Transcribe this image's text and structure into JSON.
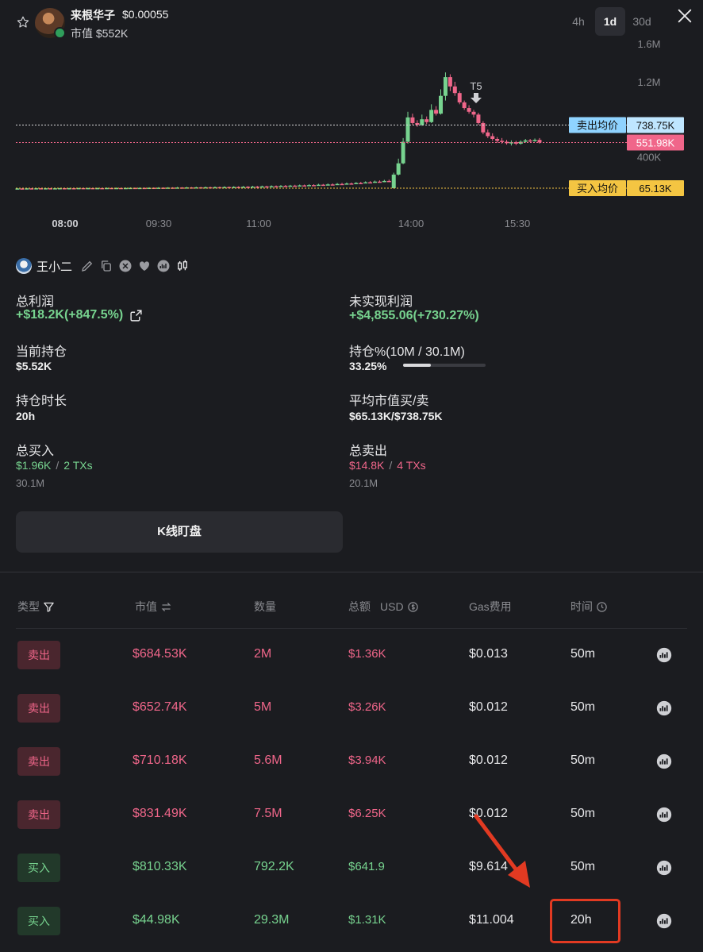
{
  "header": {
    "token_name": "来根华子",
    "token_price": "$0.00055",
    "market_cap": "市值 $552K",
    "ranges": [
      {
        "label": "4h",
        "active": false
      },
      {
        "label": "1d",
        "active": true
      },
      {
        "label": "30d",
        "active": false
      }
    ],
    "icons": {
      "favorite": "star-icon",
      "close": "close-icon"
    }
  },
  "chart_data": {
    "type": "candlestick",
    "x_ticks": [
      "08:00",
      "09:30",
      "11:00",
      "14:00",
      "15:30"
    ],
    "y_ticks": [
      "1.6M",
      "1.2M",
      "400K"
    ],
    "marker": "T5",
    "reference_lines": [
      {
        "label": "卖出均价",
        "value": "738.75K",
        "color": "#8fd3ff"
      },
      {
        "label": "",
        "value": "551.98K",
        "color": "#f0668a"
      },
      {
        "label": "买入均价",
        "value": "65.13K",
        "color": "#f4c542"
      }
    ],
    "candles": [
      {
        "o": 60,
        "c": 62,
        "h": 65,
        "l": 58
      },
      {
        "o": 62,
        "c": 61,
        "h": 64,
        "l": 59
      },
      {
        "o": 61,
        "c": 63,
        "h": 66,
        "l": 60
      },
      {
        "o": 63,
        "c": 62,
        "h": 65,
        "l": 60
      },
      {
        "o": 62,
        "c": 64,
        "h": 67,
        "l": 61
      },
      {
        "o": 64,
        "c": 63,
        "h": 66,
        "l": 61
      },
      {
        "o": 63,
        "c": 64,
        "h": 66,
        "l": 62
      },
      {
        "o": 64,
        "c": 62,
        "h": 66,
        "l": 61
      },
      {
        "o": 62,
        "c": 64,
        "h": 67,
        "l": 61
      },
      {
        "o": 64,
        "c": 65,
        "h": 68,
        "l": 62
      },
      {
        "o": 65,
        "c": 63,
        "h": 67,
        "l": 62
      },
      {
        "o": 63,
        "c": 65,
        "h": 68,
        "l": 62
      },
      {
        "o": 65,
        "c": 64,
        "h": 67,
        "l": 62
      },
      {
        "o": 64,
        "c": 66,
        "h": 69,
        "l": 63
      },
      {
        "o": 66,
        "c": 65,
        "h": 68,
        "l": 63
      },
      {
        "o": 65,
        "c": 66,
        "h": 69,
        "l": 64
      },
      {
        "o": 66,
        "c": 64,
        "h": 68,
        "l": 62
      },
      {
        "o": 64,
        "c": 66,
        "h": 70,
        "l": 63
      },
      {
        "o": 66,
        "c": 65,
        "h": 69,
        "l": 63
      },
      {
        "o": 65,
        "c": 67,
        "h": 72,
        "l": 64
      },
      {
        "o": 67,
        "c": 66,
        "h": 70,
        "l": 64
      },
      {
        "o": 66,
        "c": 67,
        "h": 71,
        "l": 65
      },
      {
        "o": 67,
        "c": 65,
        "h": 69,
        "l": 63
      },
      {
        "o": 65,
        "c": 67,
        "h": 72,
        "l": 64
      },
      {
        "o": 67,
        "c": 68,
        "h": 74,
        "l": 66
      },
      {
        "o": 68,
        "c": 66,
        "h": 71,
        "l": 64
      },
      {
        "o": 66,
        "c": 68,
        "h": 73,
        "l": 65
      },
      {
        "o": 68,
        "c": 67,
        "h": 72,
        "l": 65
      },
      {
        "o": 67,
        "c": 69,
        "h": 74,
        "l": 66
      },
      {
        "o": 69,
        "c": 68,
        "h": 73,
        "l": 66
      },
      {
        "o": 68,
        "c": 70,
        "h": 75,
        "l": 67
      },
      {
        "o": 70,
        "c": 69,
        "h": 74,
        "l": 67
      },
      {
        "o": 69,
        "c": 71,
        "h": 76,
        "l": 68
      },
      {
        "o": 71,
        "c": 70,
        "h": 75,
        "l": 68
      },
      {
        "o": 70,
        "c": 72,
        "h": 78,
        "l": 69
      },
      {
        "o": 72,
        "c": 71,
        "h": 76,
        "l": 69
      },
      {
        "o": 71,
        "c": 73,
        "h": 79,
        "l": 70
      },
      {
        "o": 73,
        "c": 72,
        "h": 77,
        "l": 70
      },
      {
        "o": 72,
        "c": 74,
        "h": 80,
        "l": 71
      },
      {
        "o": 74,
        "c": 73,
        "h": 78,
        "l": 71
      },
      {
        "o": 73,
        "c": 75,
        "h": 82,
        "l": 72
      },
      {
        "o": 75,
        "c": 74,
        "h": 80,
        "l": 72
      },
      {
        "o": 74,
        "c": 76,
        "h": 83,
        "l": 73
      },
      {
        "o": 76,
        "c": 75,
        "h": 82,
        "l": 73
      },
      {
        "o": 75,
        "c": 77,
        "h": 85,
        "l": 74
      },
      {
        "o": 77,
        "c": 76,
        "h": 83,
        "l": 74
      },
      {
        "o": 76,
        "c": 78,
        "h": 86,
        "l": 75
      },
      {
        "o": 78,
        "c": 77,
        "h": 85,
        "l": 75
      },
      {
        "o": 77,
        "c": 80,
        "h": 88,
        "l": 76
      },
      {
        "o": 80,
        "c": 78,
        "h": 87,
        "l": 76
      },
      {
        "o": 78,
        "c": 82,
        "h": 90,
        "l": 77
      },
      {
        "o": 82,
        "c": 80,
        "h": 89,
        "l": 78
      },
      {
        "o": 80,
        "c": 84,
        "h": 92,
        "l": 79
      },
      {
        "o": 84,
        "c": 82,
        "h": 91,
        "l": 80
      },
      {
        "o": 82,
        "c": 86,
        "h": 95,
        "l": 81
      },
      {
        "o": 86,
        "c": 84,
        "h": 94,
        "l": 82
      },
      {
        "o": 84,
        "c": 90,
        "h": 98,
        "l": 83
      },
      {
        "o": 90,
        "c": 88,
        "h": 99,
        "l": 85
      },
      {
        "o": 88,
        "c": 92,
        "h": 100,
        "l": 86
      },
      {
        "o": 92,
        "c": 91,
        "h": 101,
        "l": 88
      },
      {
        "o": 91,
        "c": 95,
        "h": 104,
        "l": 89
      },
      {
        "o": 95,
        "c": 93,
        "h": 103,
        "l": 90
      },
      {
        "o": 93,
        "c": 98,
        "h": 108,
        "l": 92
      },
      {
        "o": 98,
        "c": 96,
        "h": 107,
        "l": 93
      },
      {
        "o": 96,
        "c": 102,
        "h": 112,
        "l": 95
      },
      {
        "o": 102,
        "c": 100,
        "h": 110,
        "l": 97
      },
      {
        "o": 100,
        "c": 105,
        "h": 115,
        "l": 98
      },
      {
        "o": 105,
        "c": 104,
        "h": 116,
        "l": 100
      },
      {
        "o": 104,
        "c": 110,
        "h": 120,
        "l": 102
      },
      {
        "o": 110,
        "c": 108,
        "h": 122,
        "l": 104
      },
      {
        "o": 108,
        "c": 115,
        "h": 126,
        "l": 106
      },
      {
        "o": 115,
        "c": 112,
        "h": 125,
        "l": 108
      },
      {
        "o": 112,
        "c": 120,
        "h": 130,
        "l": 110
      },
      {
        "o": 120,
        "c": 118,
        "h": 132,
        "l": 114
      },
      {
        "o": 118,
        "c": 128,
        "h": 138,
        "l": 116
      },
      {
        "o": 128,
        "c": 124,
        "h": 140,
        "l": 120
      },
      {
        "o": 124,
        "c": 135,
        "h": 146,
        "l": 122
      },
      {
        "o": 135,
        "c": 130,
        "h": 148,
        "l": 126
      },
      {
        "o": 130,
        "c": 142,
        "h": 154,
        "l": 128
      },
      {
        "o": 142,
        "c": 138,
        "h": 156,
        "l": 132
      },
      {
        "o": 65,
        "c": 210,
        "h": 230,
        "l": 60
      },
      {
        "o": 210,
        "c": 330,
        "h": 380,
        "l": 200
      },
      {
        "o": 330,
        "c": 560,
        "h": 600,
        "l": 320
      },
      {
        "o": 560,
        "c": 820,
        "h": 880,
        "l": 540
      },
      {
        "o": 820,
        "c": 760,
        "h": 860,
        "l": 740
      },
      {
        "o": 760,
        "c": 740,
        "h": 790,
        "l": 720
      },
      {
        "o": 740,
        "c": 800,
        "h": 850,
        "l": 730
      },
      {
        "o": 800,
        "c": 770,
        "h": 830,
        "l": 750
      },
      {
        "o": 770,
        "c": 900,
        "h": 960,
        "l": 760
      },
      {
        "o": 900,
        "c": 860,
        "h": 940,
        "l": 840
      },
      {
        "o": 860,
        "c": 1050,
        "h": 1120,
        "l": 850
      },
      {
        "o": 1050,
        "c": 1250,
        "h": 1300,
        "l": 1000
      },
      {
        "o": 1250,
        "c": 1150,
        "h": 1280,
        "l": 1100
      },
      {
        "o": 1150,
        "c": 1080,
        "h": 1200,
        "l": 1050
      },
      {
        "o": 1080,
        "c": 980,
        "h": 1100,
        "l": 960
      },
      {
        "o": 980,
        "c": 920,
        "h": 1000,
        "l": 900
      },
      {
        "o": 920,
        "c": 880,
        "h": 950,
        "l": 860
      },
      {
        "o": 880,
        "c": 850,
        "h": 900,
        "l": 820
      },
      {
        "o": 850,
        "c": 760,
        "h": 870,
        "l": 740
      },
      {
        "o": 760,
        "c": 660,
        "h": 780,
        "l": 640
      },
      {
        "o": 660,
        "c": 620,
        "h": 690,
        "l": 600
      },
      {
        "o": 620,
        "c": 590,
        "h": 650,
        "l": 570
      },
      {
        "o": 590,
        "c": 570,
        "h": 610,
        "l": 550
      },
      {
        "o": 570,
        "c": 560,
        "h": 600,
        "l": 540
      },
      {
        "o": 560,
        "c": 545,
        "h": 580,
        "l": 530
      },
      {
        "o": 545,
        "c": 555,
        "h": 575,
        "l": 520
      },
      {
        "o": 555,
        "c": 540,
        "h": 570,
        "l": 525
      },
      {
        "o": 540,
        "c": 560,
        "h": 575,
        "l": 530
      },
      {
        "o": 560,
        "c": 575,
        "h": 590,
        "l": 550
      },
      {
        "o": 575,
        "c": 568,
        "h": 590,
        "l": 555
      },
      {
        "o": 568,
        "c": 580,
        "h": 595,
        "l": 560
      },
      {
        "o": 580,
        "c": 552,
        "h": 600,
        "l": 540
      }
    ]
  },
  "trader": {
    "name": "王小二",
    "icons": [
      "edit-icon",
      "copy-icon",
      "x-social-icon",
      "heart-icon",
      "chart-icon",
      "candlestick-icon"
    ]
  },
  "stats": {
    "total_profit": {
      "label": "总利润",
      "value": "+$18.2K(+847.5%)"
    },
    "unrealized": {
      "label": "未实现利润",
      "value": "+$4,855.06(+730.27%)"
    },
    "position": {
      "label": "当前持仓",
      "value": "$5.52K"
    },
    "position_pct": {
      "label": "持仓%(10M / 30.1M)",
      "value": "33.25%",
      "fill": 0.3325
    },
    "hold_time": {
      "label": "持仓时长",
      "value": "20h"
    },
    "avg_mcap": {
      "label": "平均市值买/卖",
      "value": "$65.13K/$738.75K"
    },
    "total_buy": {
      "label": "总买入",
      "amount": "$1.96K",
      "txs": "2 TXs",
      "qty": "30.1M"
    },
    "total_sell": {
      "label": "总卖出",
      "amount": "$14.8K",
      "txs": "4 TXs",
      "qty": "20.1M"
    },
    "separator": "/",
    "kline_button": "K线盯盘"
  },
  "table": {
    "headers": {
      "type": "类型",
      "mcap": "市值",
      "qty": "数量",
      "total": "总额",
      "usd": "USD",
      "gas": "Gas费用",
      "time": "时间"
    },
    "rows": [
      {
        "type": "卖出",
        "side": "sell",
        "mcap": "$684.53K",
        "qty": "2M",
        "amount": "$1.36K",
        "gas": "$0.013",
        "time": "50m"
      },
      {
        "type": "卖出",
        "side": "sell",
        "mcap": "$652.74K",
        "qty": "5M",
        "amount": "$3.26K",
        "gas": "$0.012",
        "time": "50m"
      },
      {
        "type": "卖出",
        "side": "sell",
        "mcap": "$710.18K",
        "qty": "5.6M",
        "amount": "$3.94K",
        "gas": "$0.012",
        "time": "50m"
      },
      {
        "type": "卖出",
        "side": "sell",
        "mcap": "$831.49K",
        "qty": "7.5M",
        "amount": "$6.25K",
        "gas": "$0.012",
        "time": "50m"
      },
      {
        "type": "买入",
        "side": "buy",
        "mcap": "$810.33K",
        "qty": "792.2K",
        "amount": "$641.9",
        "gas": "$9.614",
        "time": "50m"
      },
      {
        "type": "买入",
        "side": "buy",
        "mcap": "$44.98K",
        "qty": "29.3M",
        "amount": "$1.31K",
        "gas": "$11.004",
        "time": "20h"
      }
    ]
  },
  "colors": {
    "background": "#1b1c20",
    "green": "#77d38f",
    "red": "#f0668a",
    "annotation": "#e23a22"
  }
}
